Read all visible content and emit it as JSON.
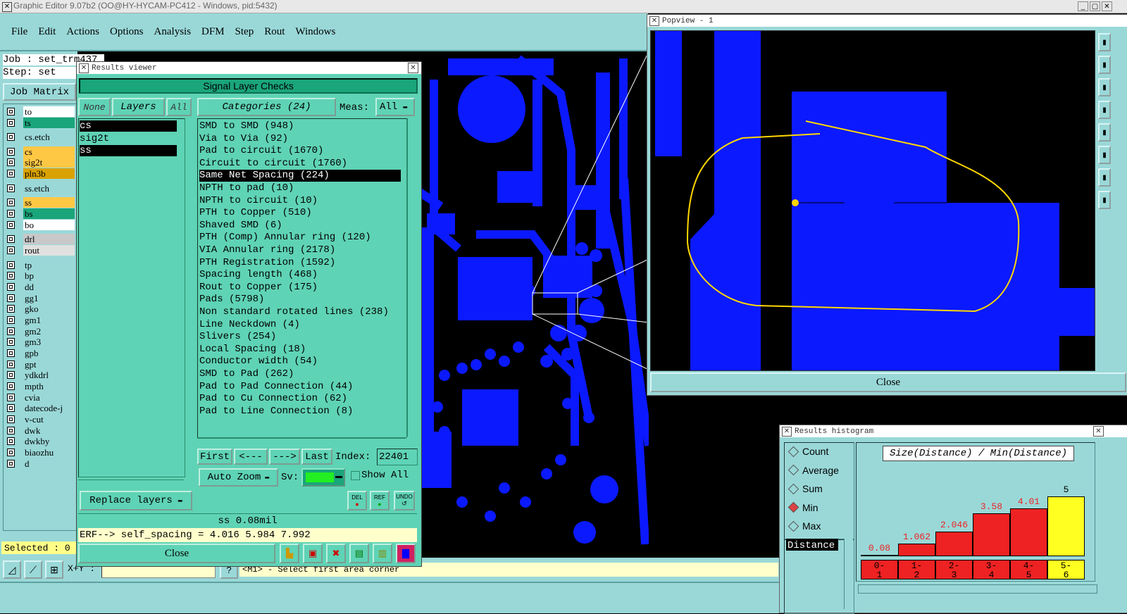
{
  "app": {
    "title": "Graphic Editor 9.07b2 (OO@HY-HYCAM-PC412 - Windows, pid:5432)",
    "menu": [
      "File",
      "Edit",
      "Actions",
      "Options",
      "Analysis",
      "DFM",
      "Step",
      "Rout",
      "Windows"
    ]
  },
  "job": {
    "job_label": "Job : set_trm437",
    "step_label": "Step: set",
    "job_matrix": "Job Matrix"
  },
  "layers": [
    {
      "name": "to",
      "color": "#ffffff"
    },
    {
      "name": "ts",
      "color": "#1aa57a"
    },
    {
      "name": "cs.etch",
      "color": "#9ad8d8"
    },
    {
      "name": "cs",
      "color": "#ffc844"
    },
    {
      "name": "sig2t",
      "color": "#ffc844"
    },
    {
      "name": "pln3b",
      "color": "#d9a200"
    },
    {
      "name": "ss.etch",
      "color": "#9ad8d8"
    },
    {
      "name": "ss",
      "color": "#ffc844"
    },
    {
      "name": "bs",
      "color": "#1aa57a"
    },
    {
      "name": "bo",
      "color": "#ffffff"
    },
    {
      "name": "drl",
      "color": "#c8c8c8"
    },
    {
      "name": "rout",
      "color": "#e0e0e0"
    },
    {
      "name": "tp",
      "color": "#9ad8d8"
    },
    {
      "name": "bp",
      "color": "#9ad8d8"
    },
    {
      "name": "dd",
      "color": "#9ad8d8"
    },
    {
      "name": "gg1",
      "color": "#9ad8d8"
    },
    {
      "name": "gko",
      "color": "#9ad8d8"
    },
    {
      "name": "gm1",
      "color": "#9ad8d8"
    },
    {
      "name": "gm2",
      "color": "#9ad8d8"
    },
    {
      "name": "gm3",
      "color": "#9ad8d8"
    },
    {
      "name": "gpb",
      "color": "#9ad8d8"
    },
    {
      "name": "gpt",
      "color": "#9ad8d8"
    },
    {
      "name": "ydkdrl",
      "color": "#9ad8d8"
    },
    {
      "name": "mpth",
      "color": "#9ad8d8"
    },
    {
      "name": "cvia",
      "color": "#9ad8d8"
    },
    {
      "name": "datecode-j",
      "color": "#9ad8d8"
    },
    {
      "name": "v-cut",
      "color": "#9ad8d8"
    },
    {
      "name": "dwk",
      "color": "#9ad8d8"
    },
    {
      "name": "dwkby",
      "color": "#9ad8d8"
    },
    {
      "name": "biaozhu",
      "color": "#9ad8d8"
    },
    {
      "name": "d",
      "color": "#9ad8d8"
    }
  ],
  "selected_label": "Selected : 0",
  "status": {
    "xy": "X+Y :",
    "hint": "<M1> - Select first area corner"
  },
  "results_viewer": {
    "title": "Results viewer",
    "heading": "Signal Layer Checks",
    "none_btn": "None",
    "layers_btn": "Layers",
    "all_btn": "All",
    "categories_btn": "Categories (24)",
    "meas_label": "Meas:",
    "meas_value": "All",
    "layer_list": [
      {
        "name": "cs",
        "selected": true
      },
      {
        "name": "sig2t",
        "selected": false
      },
      {
        "name": "ss",
        "selected": true
      }
    ],
    "categories": [
      "SMD to SMD (948)",
      "Via to Via (92)",
      "Pad to circuit (1670)",
      "Circuit to circuit (1760)",
      "Same Net Spacing (224)",
      "NPTH to pad (10)",
      "NPTH to circuit (10)",
      "PTH to Copper (510)",
      "Shaved SMD (6)",
      "PTH (Comp) Annular ring (120)",
      "VIA Annular ring (2178)",
      "PTH Registration (1592)",
      "Spacing length (468)",
      "Rout to Copper (175)",
      "Pads (5798)",
      "Non standard rotated lines (238)",
      "Line Neckdown (4)",
      "Slivers (254)",
      "Local Spacing (18)",
      "Conductor width (54)",
      "SMD to Pad (262)",
      "Pad to Pad Connection (44)",
      "Pad to Cu Connection (62)",
      "Pad to Line Connection (8)"
    ],
    "selected_category": 4,
    "first_btn": "First",
    "prev_btn": "<---",
    "next_btn": "--->",
    "last_btn": "Last",
    "index_label": "Index:",
    "index_value": "22401",
    "auto_zoom": "Auto Zoom",
    "sv_label": "Sv:",
    "show_all": "Show All",
    "replace_layers": "Replace layers",
    "del_label": "DEL",
    "ref_label": "REF",
    "undo_label": "UNDO",
    "measure": "ss 0.08mil",
    "erf": "ERF--> self_spacing = 4.016 5.984 7.992",
    "close": "Close"
  },
  "popview": {
    "title": "Popview - 1",
    "close": "Close"
  },
  "histogram": {
    "title": "Results histogram",
    "options": [
      {
        "label": "Count",
        "on": false
      },
      {
        "label": "Average",
        "on": false
      },
      {
        "label": "Sum",
        "on": false
      },
      {
        "label": "Min",
        "on": true
      },
      {
        "label": "Max",
        "on": false
      }
    ],
    "list_item": "Distance",
    "chart_title": "Size(Distance) / Min(Distance)",
    "bars": [
      {
        "range": "0-\n1",
        "value": "0.08",
        "color": "#ee2222"
      },
      {
        "range": "1-\n2",
        "value": "1.062",
        "color": "#ee2222"
      },
      {
        "range": "2-\n3",
        "value": "2.046",
        "color": "#ee2222"
      },
      {
        "range": "3-\n4",
        "value": "3.58",
        "color": "#ee2222"
      },
      {
        "range": "4-\n5",
        "value": "4.01",
        "color": "#ee2222"
      },
      {
        "range": "5-\n6",
        "value": "5",
        "color": "#ffff22"
      }
    ]
  }
}
